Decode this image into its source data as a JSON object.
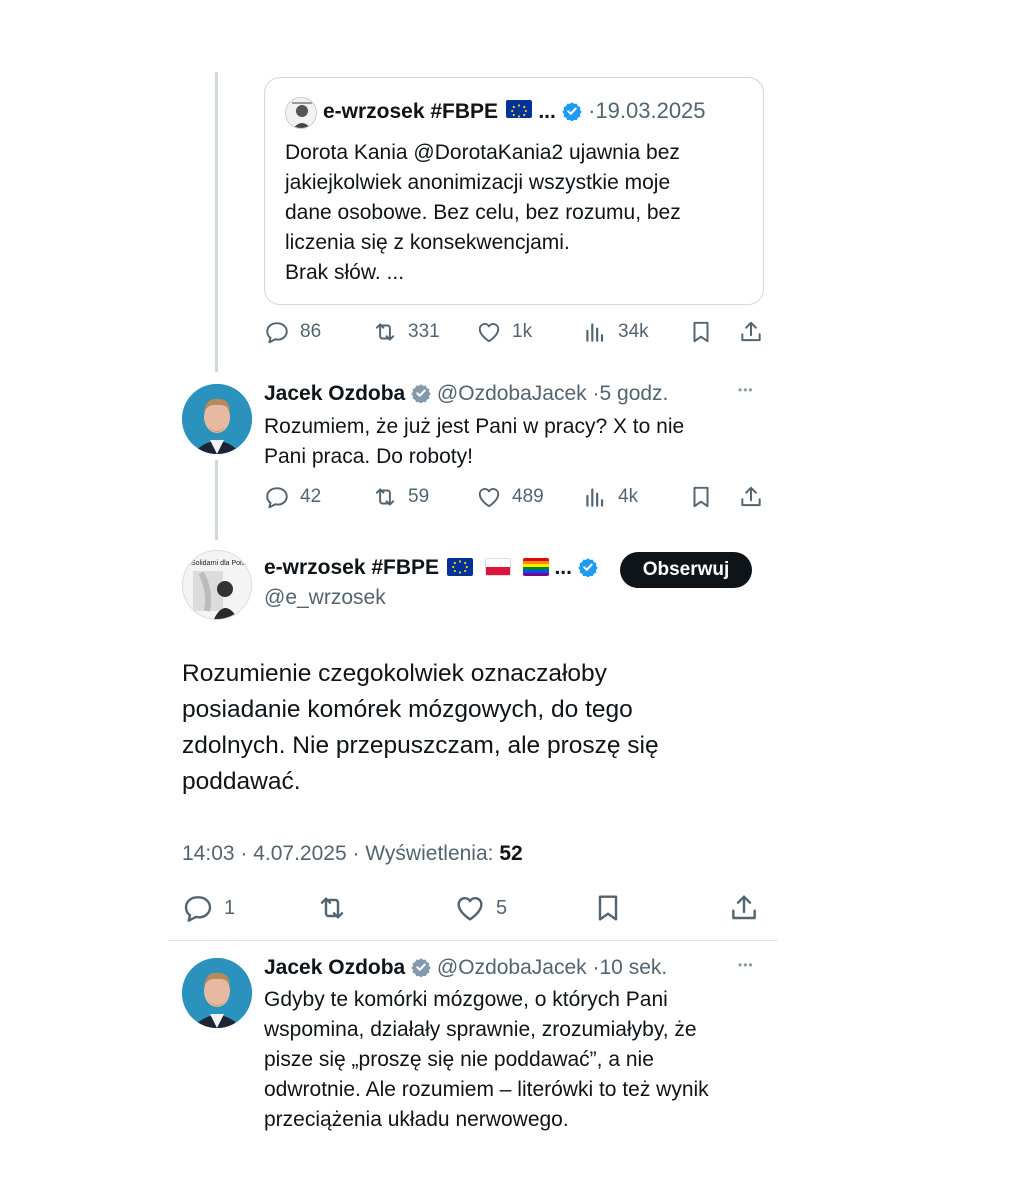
{
  "quoted": {
    "author_name": "e-wrzosek #FBPE",
    "ellipsis": "...",
    "date": "19.03.2025",
    "text_lines": [
      "Dorota Kania @DorotaKania2 ujawnia bez",
      "jakiejkolwiek anonimizacji wszystkie moje",
      "dane osobowe. Bez celu, bez rozumu, bez",
      "liczenia się z konsekwencjami.",
      "Brak słów. ..."
    ]
  },
  "quoted_actions": {
    "replies": "86",
    "reposts": "331",
    "likes": "1k",
    "views": "34k"
  },
  "reply1": {
    "author_name": "Jacek Ozdoba",
    "handle": "@OzdobaJacek",
    "time": "5 godz.",
    "text_lines": [
      "Rozumiem, że już jest Pani w pracy? X to nie",
      "Pani praca. Do roboty!"
    ],
    "actions": {
      "replies": "42",
      "reposts": "59",
      "likes": "489",
      "views": "4k"
    }
  },
  "main": {
    "author_name": "e-wrzosek #FBPE",
    "ellipsis": "...",
    "handle": "@e_wrzosek",
    "follow_label": "Obserwuj",
    "avatar_caption": "Solidarni dla Polski",
    "text_lines": [
      "Rozumienie czegokolwiek oznaczałoby",
      "posiadanie komórek mózgowych, do tego",
      "zdolnych. Nie przepuszczam, ale proszę się",
      "poddawać."
    ],
    "timestamp": "14:03 · 4.07.2025 · Wyświetlenia:",
    "views": "52",
    "actions": {
      "replies": "1",
      "likes": "5"
    }
  },
  "reply2": {
    "author_name": "Jacek Ozdoba",
    "handle": "@OzdobaJacek",
    "time": "10 sek.",
    "text_lines": [
      "Gdyby te komórki mózgowe, o których Pani",
      "wspomina, działały sprawnie, zrozumiałyby, że",
      "pisze się „proszę się nie poddawać”, a nie",
      "odwrotnie. Ale rozumiem – literówki to też wynik",
      "przeciążenia układu nerwowego."
    ]
  },
  "separator_dot": "·",
  "more_glyph": "•••",
  "colors": {
    "verified_blue": "#1d9bf0",
    "verified_gray": "#829aab",
    "muted": "#536471",
    "thread_line": "#cfd9de",
    "follow_bg": "#0f1419"
  }
}
